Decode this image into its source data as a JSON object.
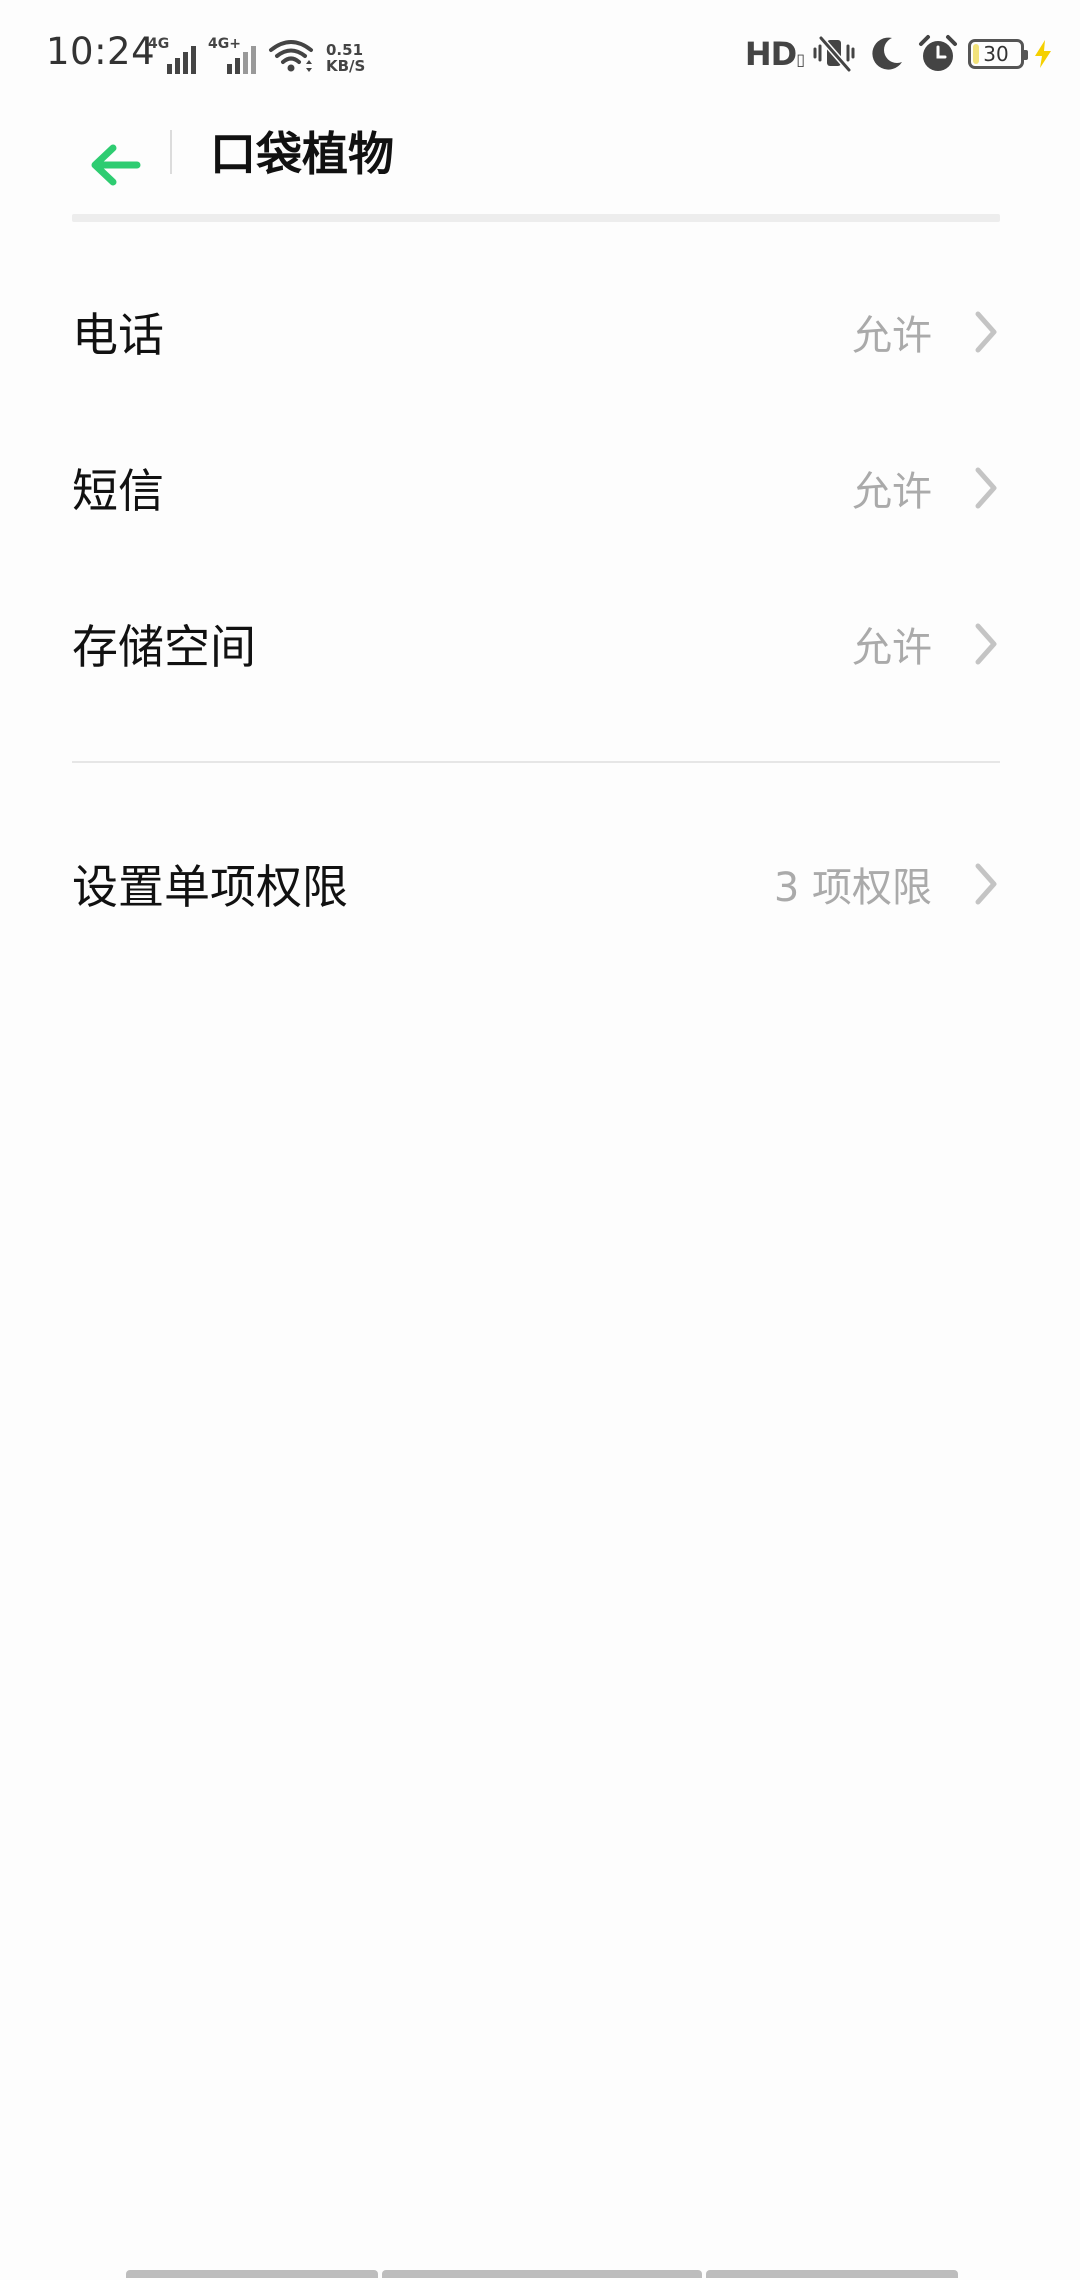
{
  "status_bar": {
    "time": "10:24",
    "network_1": "4G",
    "network_2": "4G+",
    "speed_value": "0.51",
    "speed_unit": "KB/S",
    "hd_label": "HD",
    "battery_level": "30",
    "icons": [
      "signal-icon",
      "signal-icon",
      "wifi-icon",
      "vibrate-off-icon",
      "moon-icon",
      "alarm-icon",
      "battery-icon",
      "charging-bolt-icon"
    ]
  },
  "appbar": {
    "title": "口袋植物",
    "back_icon": "arrow-left-icon",
    "accent_color": "#2ecc71"
  },
  "permissions": [
    {
      "label": "电话",
      "value": "允许"
    },
    {
      "label": "短信",
      "value": "允许"
    },
    {
      "label": "存储空间",
      "value": "允许"
    }
  ],
  "single_permission": {
    "label": "设置单项权限",
    "value": "3 项权限"
  }
}
